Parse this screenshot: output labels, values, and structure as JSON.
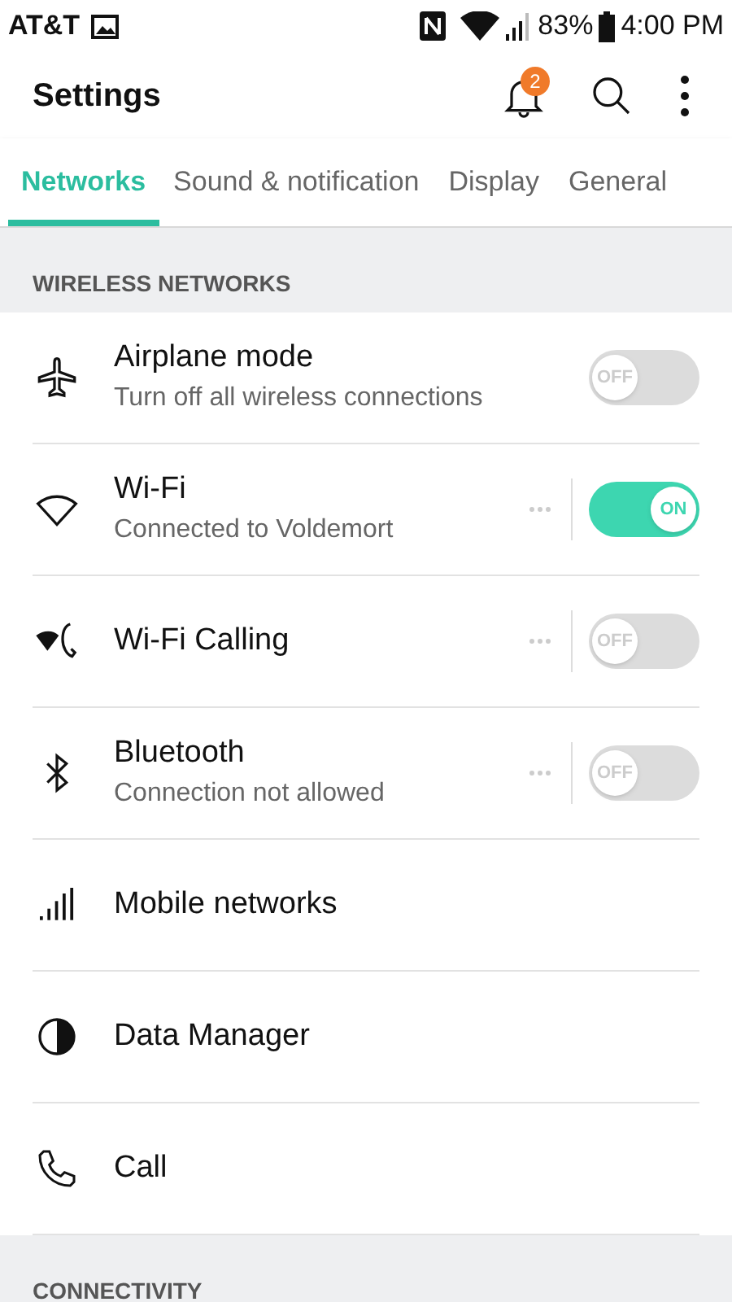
{
  "status_bar": {
    "carrier": "AT&T",
    "battery": "83%",
    "time": "4:00 PM"
  },
  "header": {
    "title": "Settings",
    "notification_badge": "2"
  },
  "tabs": [
    {
      "label": "Networks",
      "selected": true
    },
    {
      "label": "Sound & notification",
      "selected": false
    },
    {
      "label": "Display",
      "selected": false
    },
    {
      "label": "General",
      "selected": false
    }
  ],
  "sections": [
    {
      "title": "WIRELESS NETWORKS",
      "items": [
        {
          "kind": "switch",
          "title": "Airplane mode",
          "subtitle": "Turn off all wireless connections",
          "on": false,
          "switch_label": "OFF"
        },
        {
          "kind": "switch_menu",
          "title": "Wi-Fi",
          "subtitle": "Connected to Voldemort",
          "on": true,
          "switch_label": "ON"
        },
        {
          "kind": "switch_menu",
          "title": "Wi-Fi Calling",
          "on": false,
          "switch_label": "OFF"
        },
        {
          "kind": "switch_menu",
          "title": "Bluetooth",
          "subtitle": "Connection not allowed",
          "on": false,
          "switch_label": "OFF"
        },
        {
          "kind": "link",
          "title": "Mobile networks"
        },
        {
          "kind": "link",
          "title": "Data Manager"
        },
        {
          "kind": "link",
          "title": "Call"
        }
      ]
    },
    {
      "title": "CONNECTIVITY"
    }
  ]
}
